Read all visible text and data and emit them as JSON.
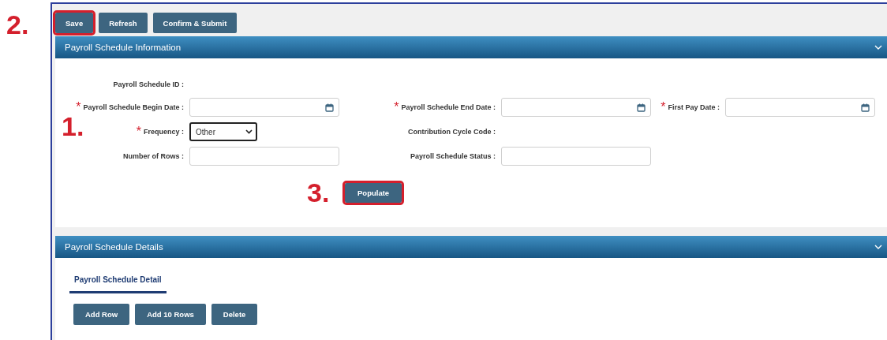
{
  "toolbar": [
    {
      "label": "Save",
      "highlighted": true,
      "annotation": "2."
    },
    {
      "label": "Refresh",
      "highlighted": false
    },
    {
      "label": "Confirm & Submit",
      "highlighted": false
    }
  ],
  "info_section": {
    "title": "Payroll Schedule Information",
    "expanded": true,
    "rows": [
      [
        {
          "label": "Payroll Schedule ID :",
          "kind": "readonly"
        }
      ],
      [
        {
          "required_mark": "*",
          "label": "Payroll Schedule Begin Date :",
          "kind": "date"
        },
        {
          "required_mark": "*",
          "label": "Payroll Schedule End Date :",
          "kind": "date"
        },
        {
          "required_mark": "*",
          "label": "First Pay Date :",
          "kind": "date"
        }
      ],
      [
        {
          "required_mark": "*",
          "label": "Frequency :",
          "kind": "select",
          "value": "Other",
          "annotation": "1."
        },
        {
          "label": "Contribution Cycle Code :",
          "kind": "readonly"
        }
      ],
      [
        {
          "label": "Number of Rows :",
          "kind": "text"
        },
        {
          "label": "Payroll Schedule Status :",
          "kind": "text"
        }
      ]
    ],
    "action": {
      "label": "Populate",
      "highlighted": true,
      "annotation": "3."
    }
  },
  "details_section": {
    "title": "Payroll Schedule Details",
    "expanded": true,
    "tabs": [
      {
        "label": "Payroll Schedule Detail",
        "selected": true
      }
    ],
    "buttons": [
      "Add Row",
      "Add 10 Rows",
      "Delete"
    ]
  }
}
